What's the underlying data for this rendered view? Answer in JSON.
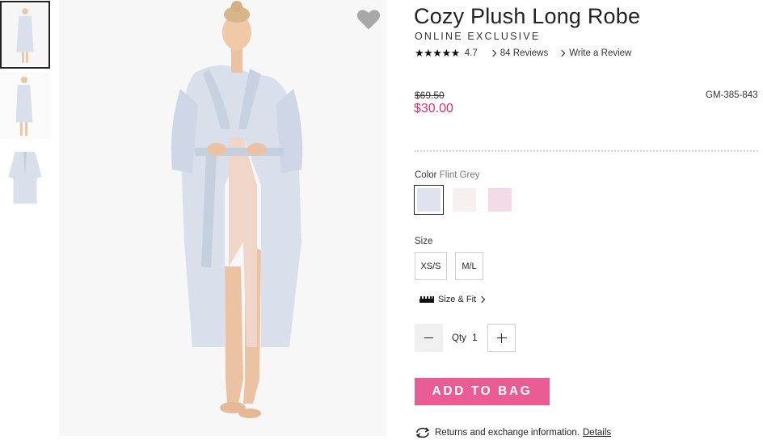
{
  "product": {
    "title": "Cozy Plush Long Robe",
    "badge": "ONLINE EXCLUSIVE",
    "stars": "★★★★★",
    "rating": "4.7",
    "reviews_link": "84 Reviews",
    "write_review_link": "Write a Review",
    "price_original": "$69.50",
    "price_sale": "$30.00",
    "sku": "GM-385-843"
  },
  "color": {
    "label": "Color",
    "selected": "Flint Grey",
    "swatches": [
      {
        "name": "Flint Grey",
        "hex": "#dfe3ee"
      },
      {
        "name": "Ivory",
        "hex": "#f6f1ee"
      },
      {
        "name": "Pink",
        "hex": "#f3dbe8"
      }
    ]
  },
  "size": {
    "label": "Size",
    "options": [
      "XS/S",
      "M/L"
    ],
    "fit_link": "Size & Fit"
  },
  "quantity": {
    "label": "Qty",
    "value": "1"
  },
  "actions": {
    "add_to_bag": "ADD TO BAG"
  },
  "returns": {
    "text": "Returns and exchange information.",
    "link": "Details"
  },
  "colors": {
    "sale_price": "#e0306b",
    "add_button": "#e95c94",
    "robe": "#d9e0ec"
  }
}
